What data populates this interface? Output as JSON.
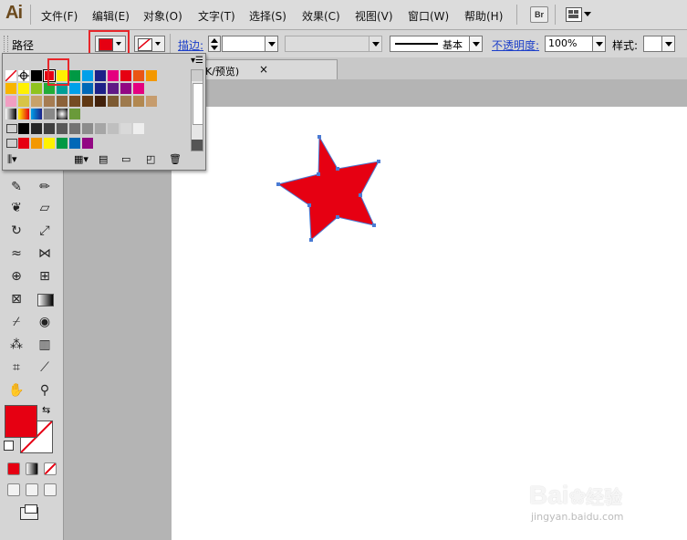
{
  "app": {
    "logo": "Ai"
  },
  "menu": [
    "文件(F)",
    "编辑(E)",
    "对象(O)",
    "文字(T)",
    "选择(S)",
    "效果(C)",
    "视图(V)",
    "窗口(W)",
    "帮助(H)"
  ],
  "toolbar_right": {
    "bridge_label": "Br"
  },
  "control": {
    "selection_label": "路径",
    "stroke_label": "描边:",
    "stroke_style_label": "基本",
    "opacity_label": "不透明度:",
    "opacity_value": "100%",
    "style_label": "样式:"
  },
  "document": {
    "tab_title": "K/预览)",
    "close_icon": "×"
  },
  "colors": {
    "fill": "#e60012",
    "accent_highlight": "#e8262a",
    "star": "#e60012"
  },
  "swatches": {
    "row1": [
      "#ffffff",
      "#ffffff",
      "#000000",
      "#e60012",
      "#fff100",
      "#009944",
      "#00a0e9",
      "#1d2088",
      "#e4007f",
      "#e60012",
      "#ea5514",
      "#f39800"
    ],
    "row2": [
      "#f8b500",
      "#fff100",
      "#8fc31f",
      "#22ac38",
      "#009e96",
      "#00a0e9",
      "#0068b7",
      "#1d2088",
      "#601986",
      "#920783",
      "#e4007f"
    ],
    "row3": [
      "#f19ec2",
      "#d7c447",
      "#c7a16a",
      "#a67c52",
      "#8c6239",
      "#754c24",
      "#603813",
      "#42210b",
      "#7d5a32",
      "#9e7a4d",
      "#b28850",
      "#c69c6d"
    ],
    "gray_row": [
      "#000000",
      "#262626",
      "#404040",
      "#595959",
      "#737373",
      "#8c8c8c",
      "#a6a6a6",
      "#bfbfbf",
      "#d9d9d9",
      "#eeeeee"
    ],
    "group_row": [
      "#e60012",
      "#f39800",
      "#fff100",
      "#009944",
      "#0068b7",
      "#920783"
    ]
  },
  "watermark": {
    "brand": "Bai",
    "brand2": "经验",
    "url": "jingyan.baidu.com"
  }
}
